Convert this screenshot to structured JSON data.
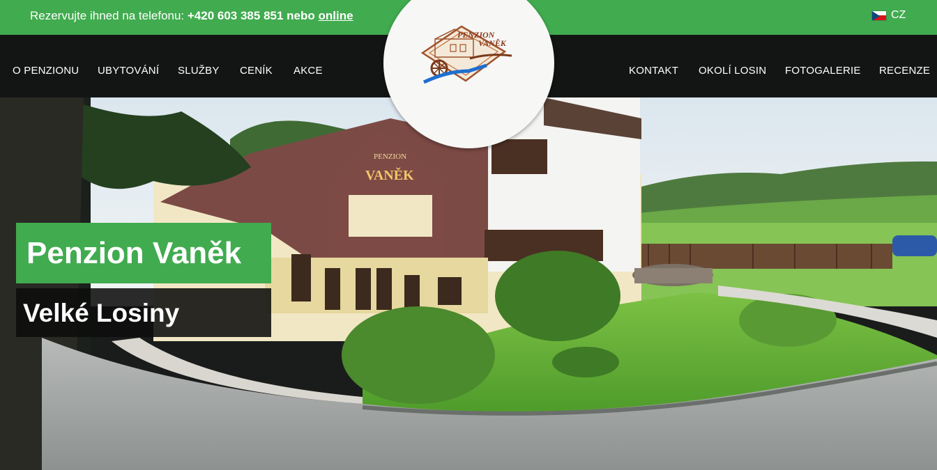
{
  "topbar": {
    "phone_prefix": "Rezervujte ihned na telefonu: ",
    "phone_number": "+420 603 385 851",
    "phone_joiner": " nebo ",
    "online_link": "online",
    "language": "CZ",
    "color": "#41ab4f"
  },
  "nav": {
    "left": [
      "O PENZIONU",
      "UBYTOVÁNÍ",
      "SLUŽBY",
      "CENÍK",
      "AKCE"
    ],
    "right": [
      "KONTAKT",
      "OKOLÍ LOSIN",
      "FOTOGALERIE",
      "RECENZE"
    ]
  },
  "logo": {
    "line1": "PENZION",
    "line2": "VANĚK"
  },
  "hero": {
    "title": "Penzion Vaněk",
    "subtitle": "Velké Losiny",
    "building_sign_line1": "PENZION",
    "building_sign_line2": "VANĚK"
  }
}
